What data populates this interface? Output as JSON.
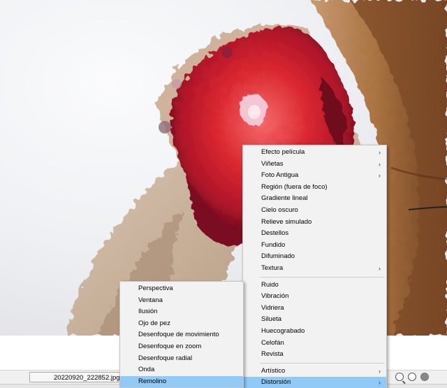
{
  "status_bar": {
    "filename": "20220920_222852.jpg"
  },
  "context_menu": {
    "items": [
      {
        "label": "Efecto película",
        "submenu": true
      },
      {
        "label": "Viñetas",
        "submenu": true
      },
      {
        "label": "Foto Antigua",
        "submenu": true
      },
      {
        "label": "Región (fuera de foco)",
        "submenu": false
      },
      {
        "label": "Gradiente lineal",
        "submenu": false
      },
      {
        "label": "Cielo oscuro",
        "submenu": false
      },
      {
        "label": "Relieve simulado",
        "submenu": false
      },
      {
        "label": "Destellos",
        "submenu": false
      },
      {
        "label": "Fundido",
        "submenu": false
      },
      {
        "label": "Difuminado",
        "submenu": false
      },
      {
        "label": "Textura",
        "submenu": true
      },
      {
        "separator": true
      },
      {
        "label": "Ruido",
        "submenu": false
      },
      {
        "label": "Vibración",
        "submenu": false
      },
      {
        "label": "Vidriera",
        "submenu": false
      },
      {
        "label": "Silueta",
        "submenu": false
      },
      {
        "label": "Huecograbado",
        "submenu": false
      },
      {
        "label": "Celofán",
        "submenu": false
      },
      {
        "label": "Revista",
        "submenu": false
      },
      {
        "separator": true
      },
      {
        "label": "Artístico",
        "submenu": true
      },
      {
        "label": "Distorsión",
        "submenu": true,
        "highlighted": true
      }
    ],
    "arrow_glyph": "›"
  },
  "distortion_submenu": {
    "items": [
      {
        "label": "Perspectiva"
      },
      {
        "label": "Ventana"
      },
      {
        "label": "Ilusión"
      },
      {
        "label": "Ojo de pez"
      },
      {
        "label": "Desenfoque de movimiento"
      },
      {
        "label": "Desenfoque en zoom"
      },
      {
        "label": "Desenfoque radial"
      },
      {
        "label": "Onda"
      },
      {
        "label": "Remolino",
        "highlighted": true
      }
    ]
  },
  "colors": {
    "menu_background": "#f2f2f2",
    "menu_highlight": "#91c9f7",
    "flower_red": "#d8262e",
    "flower_dark": "#7a1020",
    "petal_pink": "#e9b7c8",
    "beige": "#c9ad92",
    "brown_wood": "#8a5a35"
  }
}
